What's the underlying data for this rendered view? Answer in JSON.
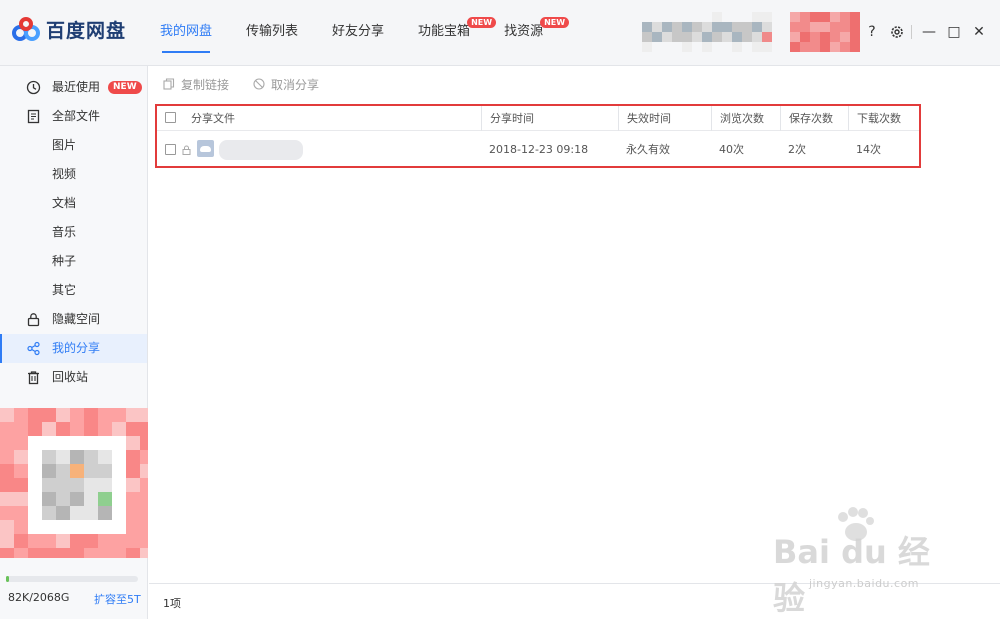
{
  "app": {
    "logo_text": "百度网盘"
  },
  "nav": [
    {
      "label": "我的网盘",
      "active": true,
      "badge": ""
    },
    {
      "label": "传输列表",
      "active": false,
      "badge": ""
    },
    {
      "label": "好友分享",
      "active": false,
      "badge": ""
    },
    {
      "label": "功能宝箱",
      "active": false,
      "badge": "NEW"
    },
    {
      "label": "找资源",
      "active": false,
      "badge": "NEW"
    }
  ],
  "window_controls": {
    "help": "?",
    "settings_icon": "gear-icon",
    "minimize": "—",
    "maximize": "□",
    "close": "✕"
  },
  "sidebar": {
    "items": [
      {
        "label": "最近使用",
        "icon": "clock-icon",
        "badge": "NEW"
      },
      {
        "label": "全部文件",
        "icon": "document-icon",
        "badge": ""
      },
      {
        "label": "图片",
        "icon": "",
        "badge": ""
      },
      {
        "label": "视频",
        "icon": "",
        "badge": ""
      },
      {
        "label": "文档",
        "icon": "",
        "badge": ""
      },
      {
        "label": "音乐",
        "icon": "",
        "badge": ""
      },
      {
        "label": "种子",
        "icon": "",
        "badge": ""
      },
      {
        "label": "其它",
        "icon": "",
        "badge": ""
      },
      {
        "label": "隐藏空间",
        "icon": "lock-icon",
        "badge": ""
      },
      {
        "label": "我的分享",
        "icon": "share-icon",
        "badge": ""
      },
      {
        "label": "回收站",
        "icon": "trash-icon",
        "badge": ""
      }
    ],
    "active_index": 9,
    "storage_text": "82K/2068G",
    "storage_link": "扩容至5T",
    "storage_fraction": 0.02
  },
  "toolbar": {
    "copy_link": "复制链接",
    "cancel_share": "取消分享"
  },
  "table": {
    "headers": [
      "分享文件",
      "分享时间",
      "失效时间",
      "浏览次数",
      "保存次数",
      "下载次数"
    ],
    "rows": [
      {
        "file": "",
        "time": "2018-12-23 09:18",
        "expire": "永久有效",
        "views": "40次",
        "saves": "2次",
        "downloads": "14次"
      }
    ]
  },
  "footer": {
    "count_text": "1项"
  },
  "watermark": {
    "text": "Bai  du 经验",
    "sub": "jingyan.baidu.com"
  },
  "colors": {
    "accent": "#2f7cf5",
    "badge": "#ef4a4a",
    "highlight_border": "#e23b3b"
  }
}
